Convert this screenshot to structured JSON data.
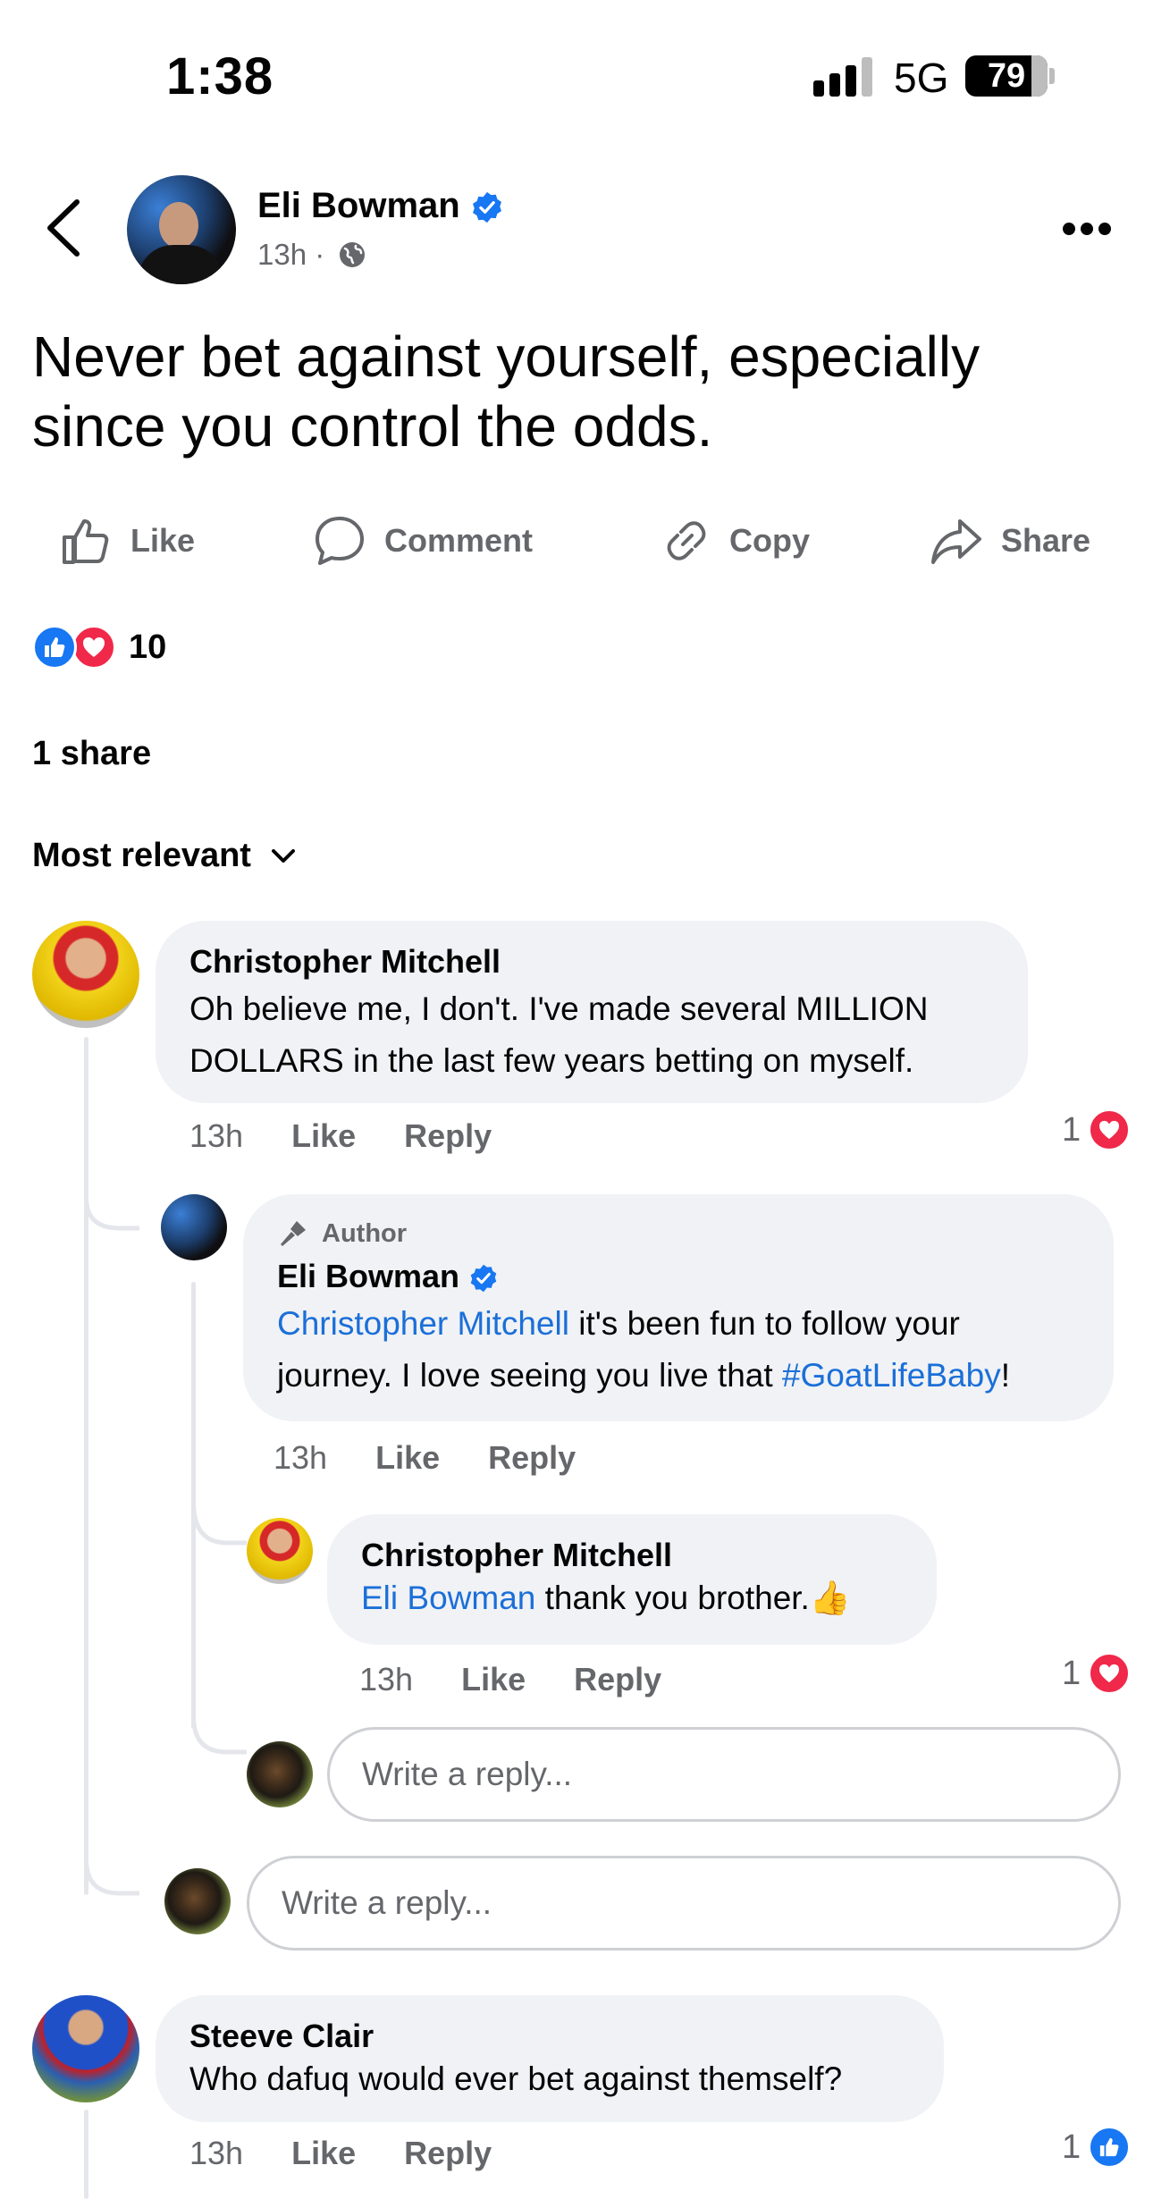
{
  "status_bar": {
    "time": "1:38",
    "network": "5G",
    "battery": "79"
  },
  "post": {
    "author": "Eli Bowman",
    "time": "13h",
    "text": "Never bet against yourself, especially since you control the odds.",
    "reaction_count": "10",
    "shares": "1 share"
  },
  "actions": {
    "like": "Like",
    "comment": "Comment",
    "copy": "Copy",
    "share": "Share"
  },
  "sort_label": "Most relevant",
  "comments": [
    {
      "name": "Christopher Mitchell",
      "text": "Oh believe me, I don't. I've made several MILLION DOLLARS in the last few years betting on myself.",
      "time": "13h",
      "like": "Like",
      "reply": "Reply",
      "reactions": "1"
    },
    {
      "tag": "Author",
      "name": "Eli Bowman",
      "mention": "Christopher Mitchell",
      "text_a": " it's been fun to follow your journey. I love seeing you live that ",
      "hashtag": "#GoatLifeBaby",
      "text_b": "!",
      "time": "13h",
      "like": "Like",
      "reply": "Reply"
    },
    {
      "name": "Christopher Mitchell",
      "mention": "Eli Bowman",
      "text": " thank you brother.",
      "emoji": "👍",
      "time": "13h",
      "like": "Like",
      "reply": "Reply",
      "reactions": "1"
    },
    {
      "name": "Steeve Clair",
      "text": "Who dafuq would ever bet against themself?",
      "time": "13h",
      "like": "Like",
      "reply": "Reply",
      "reactions": "1"
    }
  ],
  "reply_placeholder": "Write a reply...",
  "colors": {
    "accent": "#1877f2",
    "love": "#f02849",
    "mention": "#1b6fd8",
    "bubble": "#f0f2f5",
    "muted": "#65676b"
  }
}
